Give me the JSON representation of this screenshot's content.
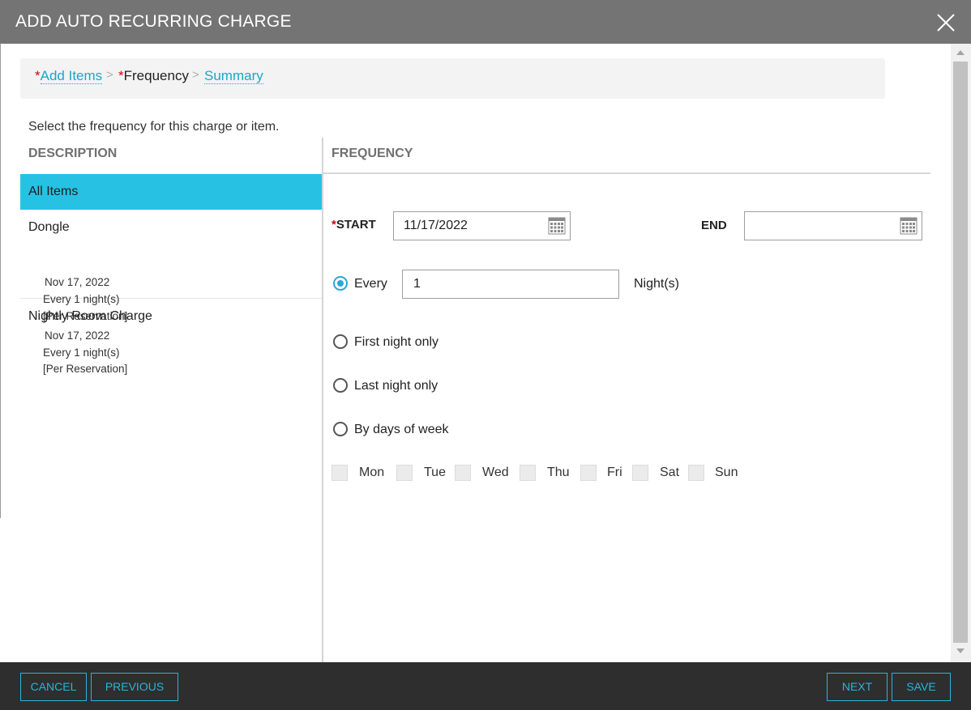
{
  "dialog": {
    "title": "ADD AUTO RECURRING CHARGE"
  },
  "breadcrumb": {
    "required_mark": "*",
    "steps": [
      {
        "label": "Add Items",
        "required": true,
        "link": true
      },
      {
        "label": "Frequency",
        "required": true,
        "link": false
      },
      {
        "label": "Summary",
        "required": false,
        "link": true
      }
    ],
    "separator": ">"
  },
  "instruction": "Select the frequency for this charge or item.",
  "columns": {
    "description": "DESCRIPTION",
    "frequency": "FREQUENCY"
  },
  "items": [
    {
      "name": "All Items",
      "selected": true
    },
    {
      "name": "Dongle",
      "date": "Nov 17, 2022",
      "frequency": "Every 1 night(s)",
      "basis": "[Per Reservation]",
      "selected": false
    },
    {
      "name": "Nightly Room Charge",
      "date": "Nov 17, 2022",
      "frequency": "Every 1 night(s)",
      "basis": "[Per Reservation]",
      "selected": false
    }
  ],
  "form": {
    "start_label": "START",
    "start_required": true,
    "start_value": "11/17/2022",
    "end_label": "END",
    "end_value": "",
    "options": {
      "every": {
        "label": "Every",
        "value": "1",
        "unit": "Night(s)",
        "checked": true
      },
      "first_night": {
        "label": "First night only",
        "checked": false
      },
      "last_night": {
        "label": "Last night only",
        "checked": false
      },
      "by_days": {
        "label": "By days of week",
        "checked": false
      }
    },
    "days": [
      {
        "label": "Mon",
        "checked": false
      },
      {
        "label": "Tue",
        "checked": false
      },
      {
        "label": "Wed",
        "checked": false
      },
      {
        "label": "Thu",
        "checked": false
      },
      {
        "label": "Fri",
        "checked": false
      },
      {
        "label": "Sat",
        "checked": false
      },
      {
        "label": "Sun",
        "checked": false
      }
    ]
  },
  "footer": {
    "cancel": "CANCEL",
    "previous": "PREVIOUS",
    "next": "NEXT",
    "save": "SAVE"
  },
  "icons": {
    "close": "close-icon",
    "calendar": "calendar-icon"
  },
  "colors": {
    "title_bar": "#747474",
    "accent": "#27c1e4",
    "link": "#1aa7c9",
    "required": "#d0021b",
    "footer": "#2e2e2e"
  }
}
